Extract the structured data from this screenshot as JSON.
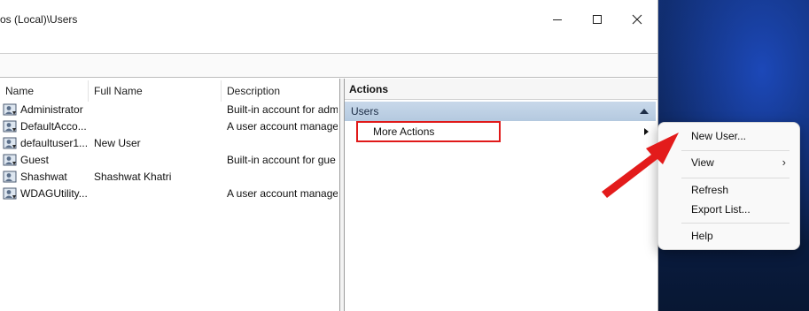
{
  "window": {
    "title": "os (Local)\\Users"
  },
  "list": {
    "columns": [
      "Name",
      "Full Name",
      "Description"
    ],
    "rows": [
      {
        "name": "Administrator",
        "full_name": "",
        "description": "Built-in account for adm"
      },
      {
        "name": "DefaultAcco...",
        "full_name": "",
        "description": "A user account manage"
      },
      {
        "name": "defaultuser1...",
        "full_name": "New User",
        "description": ""
      },
      {
        "name": "Guest",
        "full_name": "",
        "description": "Built-in account for gue"
      },
      {
        "name": "Shashwat",
        "full_name": "Shashwat Khatri",
        "description": ""
      },
      {
        "name": "WDAGUtility...",
        "full_name": "",
        "description": "A user account manage"
      }
    ]
  },
  "actions": {
    "title": "Actions",
    "section": "Users",
    "more_actions": "More Actions"
  },
  "context_menu": {
    "items": [
      "New User...",
      "View",
      "Refresh",
      "Export List...",
      "Help"
    ]
  },
  "colors": {
    "highlight_red": "#e01919",
    "section_blue": "#b4c9df"
  },
  "icons": {
    "minimize": "minimize-icon",
    "maximize": "maximize-icon",
    "close": "close-icon",
    "user": "user-account-icon"
  }
}
